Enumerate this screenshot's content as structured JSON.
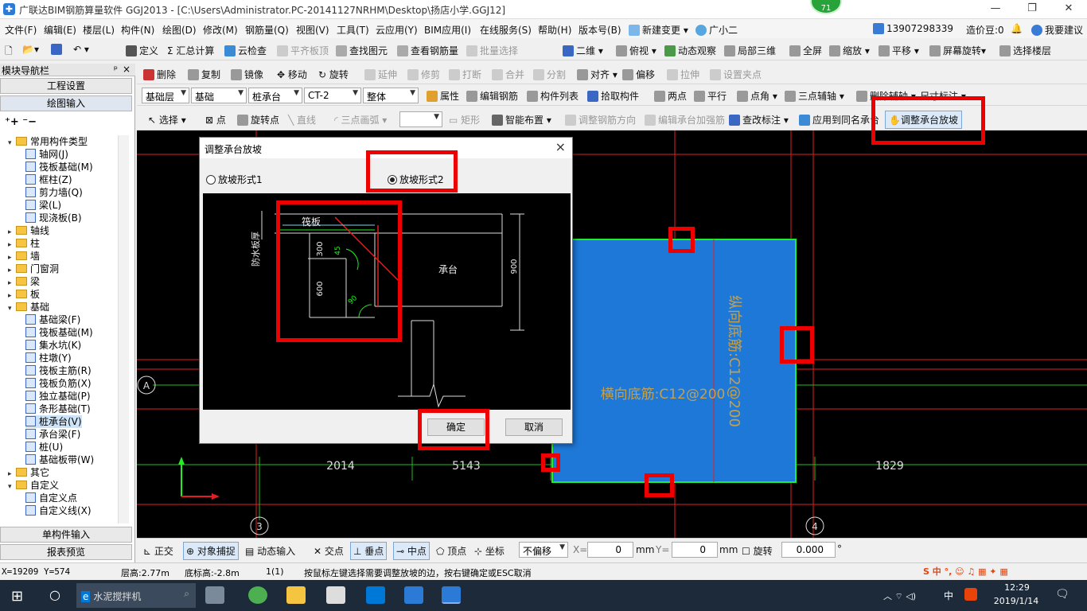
{
  "title_bar": {
    "text": "广联达BIM钢筋算量软件 GGJ2013 - [C:\\Users\\Administrator.PC-20141127NRHM\\Desktop\\扬店小学.GGJ12]",
    "badge": "71"
  },
  "menu": [
    "文件(F)",
    "编辑(E)",
    "楼层(L)",
    "构件(N)",
    "绘图(D)",
    "修改(M)",
    "钢筋量(Q)",
    "视图(V)",
    "工具(T)",
    "云应用(Y)",
    "BIM应用(I)",
    "在线服务(S)",
    "帮助(H)",
    "版本号(B)",
    "新建变更",
    "广小二"
  ],
  "menu_right": {
    "phone": "13907298339",
    "cost": "造价豆:0",
    "suggest": "我要建议"
  },
  "toolbar1": [
    "定义",
    "汇总计算",
    "云检查",
    "平齐板顶",
    "查找图元",
    "查看钢筋量",
    "批量选择",
    "二维",
    "俯视",
    "动态观察",
    "局部三维",
    "全屏",
    "缩放",
    "平移",
    "屏幕旋转",
    "选择楼层"
  ],
  "toolbar2": [
    "删除",
    "复制",
    "镜像",
    "移动",
    "旋转",
    "延伸",
    "修剪",
    "打断",
    "合并",
    "分割",
    "对齐",
    "偏移",
    "拉伸",
    "设置夹点"
  ],
  "toolbar3": {
    "floor": "基础层",
    "category": "基础",
    "type": "桩承台",
    "name": "CT-2",
    "mode": "整体",
    "buttons": [
      "属性",
      "编辑钢筋",
      "构件列表",
      "拾取构件",
      "两点",
      "平行",
      "点角",
      "三点辅轴",
      "删除辅轴",
      "尺寸标注"
    ]
  },
  "toolbar4": [
    "选择",
    "点",
    "旋转点",
    "直线",
    "三点画弧",
    "矩形",
    "智能布置",
    "调整钢筋方向",
    "编辑承台加强筋",
    "查改标注",
    "应用到同名承台",
    "调整承台放坡"
  ],
  "left_panel": {
    "title": "模块导航栏",
    "pin": "ᵖ",
    "close": "×",
    "btn_top1": "工程设置",
    "btn_top2": "绘图输入",
    "tree": [
      {
        "label": "常用构件类型",
        "level": 0,
        "exp": "▾",
        "folder": true
      },
      {
        "label": "轴网(J)",
        "level": 1
      },
      {
        "label": "筏板基础(M)",
        "level": 1
      },
      {
        "label": "框柱(Z)",
        "level": 1
      },
      {
        "label": "剪力墙(Q)",
        "level": 1
      },
      {
        "label": "梁(L)",
        "level": 1
      },
      {
        "label": "现浇板(B)",
        "level": 1
      },
      {
        "label": "轴线",
        "level": 0,
        "exp": "▸",
        "folder": true
      },
      {
        "label": "柱",
        "level": 0,
        "exp": "▸",
        "folder": true
      },
      {
        "label": "墙",
        "level": 0,
        "exp": "▸",
        "folder": true
      },
      {
        "label": "门窗洞",
        "level": 0,
        "exp": "▸",
        "folder": true
      },
      {
        "label": "梁",
        "level": 0,
        "exp": "▸",
        "folder": true
      },
      {
        "label": "板",
        "level": 0,
        "exp": "▸",
        "folder": true
      },
      {
        "label": "基础",
        "level": 0,
        "exp": "▾",
        "folder": true
      },
      {
        "label": "基础梁(F)",
        "level": 1
      },
      {
        "label": "筏板基础(M)",
        "level": 1
      },
      {
        "label": "集水坑(K)",
        "level": 1
      },
      {
        "label": "柱墩(Y)",
        "level": 1
      },
      {
        "label": "筏板主筋(R)",
        "level": 1
      },
      {
        "label": "筏板负筋(X)",
        "level": 1
      },
      {
        "label": "独立基础(P)",
        "level": 1
      },
      {
        "label": "条形基础(T)",
        "level": 1
      },
      {
        "label": "桩承台(V)",
        "level": 1
      },
      {
        "label": "承台梁(F)",
        "level": 1
      },
      {
        "label": "桩(U)",
        "level": 1
      },
      {
        "label": "基础板带(W)",
        "level": 1
      },
      {
        "label": "其它",
        "level": 0,
        "exp": "▸",
        "folder": true
      },
      {
        "label": "自定义",
        "level": 0,
        "exp": "▾",
        "folder": true
      },
      {
        "label": "自定义点",
        "level": 1
      },
      {
        "label": "自定义线(X)",
        "level": 1
      }
    ],
    "btn_bottom1": "单构件输入",
    "btn_bottom2": "报表预览"
  },
  "canvas": {
    "slab_text_v": "纵向底筋:C12@200",
    "slab_text_h": "横向底筋:C12@200",
    "dims": [
      "2014",
      "5143",
      "1829"
    ],
    "axes": [
      "A",
      "3",
      "4"
    ]
  },
  "dialog": {
    "title": "调整承台放坡",
    "close": "×",
    "option1": "放坡形式1",
    "option2": "放坡形式2",
    "selected": 2,
    "diagram": {
      "t_slab": "筏板",
      "t_cap": "承台",
      "t_wp": "防水板厚",
      "d300": "300",
      "d600": "600",
      "d900": "900",
      "a45": "45",
      "a90": "90"
    },
    "ok": "确定",
    "cancel": "取消"
  },
  "bottom_toolbar": [
    "正交",
    "对象捕捉",
    "动态输入",
    "交点",
    "垂点",
    "中点",
    "顶点",
    "坐标",
    "不偏移"
  ],
  "bottom_inputs": {
    "x_label": "X=",
    "x": "0",
    "y_label": "Y=",
    "y": "0",
    "mm": "mm",
    "rot_label": "旋转",
    "rot": "0.000",
    "deg": "°"
  },
  "status": {
    "coords": "X=19209 Y=574",
    "floor_h": "层高:2.77m",
    "bottom_h": "底标高:-2.8m",
    "count": "1(1)",
    "hint": "按鼠标左键选择需要调整放坡的边，按右键确定或ESC取消"
  },
  "taskbar": {
    "search": "水泥搅拌机",
    "time": "12:29",
    "date": "2019/1/14",
    "ime": "中"
  }
}
